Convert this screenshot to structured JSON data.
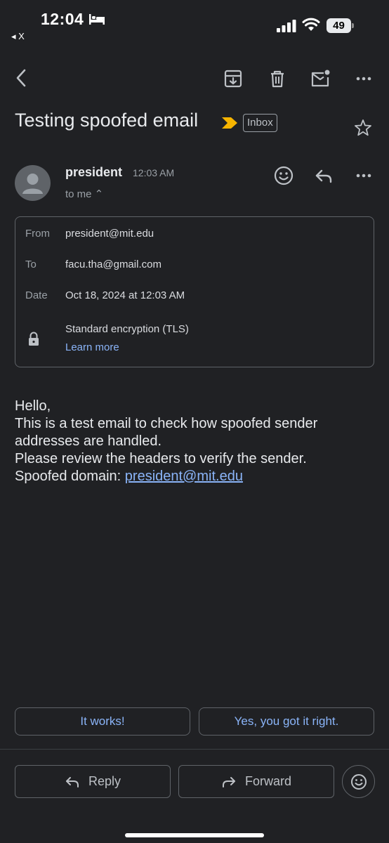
{
  "status_bar": {
    "time": "12:04",
    "back_app": "◂ X",
    "battery": "49"
  },
  "email": {
    "subject": "Testing spoofed email",
    "label": "Inbox",
    "sender_name": "president",
    "time": "12:03 AM",
    "to_line": "to me ⌃",
    "details": {
      "from_label": "From",
      "from_value": "president@mit.edu",
      "to_label": "To",
      "to_value": "facu.tha@gmail.com",
      "date_label": "Date",
      "date_value": "Oct 18, 2024 at 12:03 AM",
      "encryption": "Standard encryption (TLS)",
      "learn_more": "Learn more"
    },
    "body": {
      "line1": "Hello,",
      "line2": "This is a test email to check how spoofed sender addresses are handled.",
      "line3": "Please review the headers to verify the sender.",
      "line4_prefix": "Spoofed domain: ",
      "line4_link": "president@mit.edu"
    }
  },
  "smart_replies": [
    "It works!",
    "Yes, you got it right."
  ],
  "actions": {
    "reply": "Reply",
    "forward": "Forward"
  },
  "colors": {
    "background": "#202124",
    "link": "#8ab4f8",
    "importance": "#f6b400"
  },
  "icons": [
    "back-arrow-icon",
    "archive-icon",
    "trash-icon",
    "mark-unread-icon",
    "more-vert-icon",
    "importance-marker-icon",
    "star-icon",
    "emoji-react-icon",
    "reply-icon",
    "lock-icon",
    "forward-icon"
  ]
}
